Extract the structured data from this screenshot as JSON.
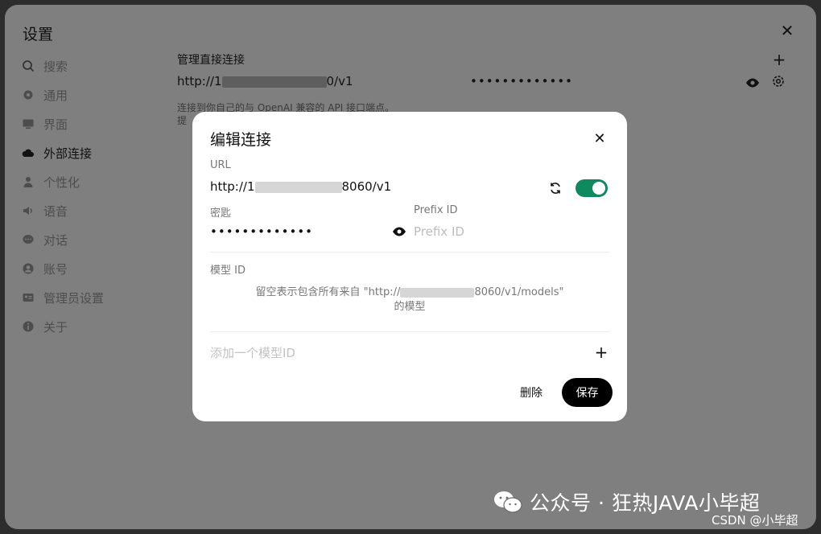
{
  "settings": {
    "title": "设置",
    "nav": [
      {
        "label": "搜索",
        "icon": "search-icon"
      },
      {
        "label": "通用",
        "icon": "gear-icon"
      },
      {
        "label": "界面",
        "icon": "monitor-icon"
      },
      {
        "label": "外部连接",
        "icon": "cloud-icon"
      },
      {
        "label": "个性化",
        "icon": "user-icon"
      },
      {
        "label": "语音",
        "icon": "speaker-icon"
      },
      {
        "label": "对话",
        "icon": "chat-icon"
      },
      {
        "label": "账号",
        "icon": "account-icon"
      },
      {
        "label": "管理员设置",
        "icon": "admin-card-icon"
      },
      {
        "label": "关于",
        "icon": "info-icon"
      }
    ],
    "active_nav": "外部连接",
    "section_title": "管理直接连接",
    "connection": {
      "url_prefix": "http://1",
      "url_suffix": "0/v1",
      "key_masked": "•••••••••••••"
    },
    "description_line1": "连接到你自己的与 OpenAI 兼容的 API 接口端点。",
    "description_line2": "提"
  },
  "modal": {
    "title": "编辑连接",
    "url_label": "URL",
    "url_prefix": "http://1",
    "url_suffix": "8060/v1",
    "toggle_on": true,
    "key_label": "密匙",
    "key_masked": "•••••••••••••",
    "prefix_label": "Prefix ID",
    "prefix_placeholder": "Prefix ID",
    "model_label": "模型 ID",
    "models_hint_prefix": "留空表示包含所有来自 \"http://",
    "models_hint_suffix": "8060/v1/models\"",
    "models_hint_line2": "的模型",
    "add_model_placeholder": "添加一个模型ID",
    "delete_label": "删除",
    "save_label": "保存"
  },
  "watermark": {
    "text": "公众号 · 狂热JAVA小毕超",
    "csdn": "CSDN @小毕超"
  },
  "colors": {
    "toggle_on": "#0f8a5f",
    "save_button": "#000000"
  }
}
